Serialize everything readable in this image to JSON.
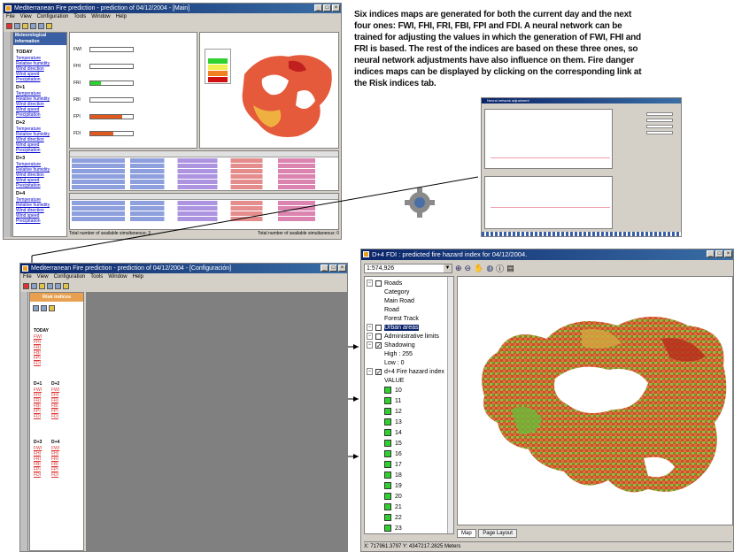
{
  "description": [
    "Six indices maps are generated for both the current day and the next",
    "four ones: FWI, FHI, FRI, FBI, FPI and FDI. A neural network can be",
    "trained for adjusting the values in which the generation of FWI, FHI and",
    "FRI is based. The rest of the indices are based on these three ones, so",
    "neural network adjustments have also influence on them. Fire danger",
    "indices maps can be displayed by clicking on the corresponding link at",
    "the Risk indices tab."
  ],
  "main_window": {
    "title": "Mediterranean Fire prediction - prediction of 04/12/2004 - [Main]",
    "menu": [
      "File",
      "View",
      "Configuration",
      "Tools",
      "Window",
      "Help"
    ],
    "left_header": "Meteorological information",
    "today": "TODAY",
    "days": [
      {
        "label": "TODAY",
        "links": [
          "Temperature",
          "Relative humidity",
          "Wind direction",
          "Wind speed",
          "Precipitation"
        ]
      },
      {
        "label": "D+1",
        "links": [
          "Temperature",
          "Relative humidity",
          "Wind direction",
          "Wind speed",
          "Precipitation"
        ]
      },
      {
        "label": "D+2",
        "links": [
          "Temperature",
          "Relative humidity",
          "Wind direction",
          "Wind speed",
          "Precipitation"
        ]
      },
      {
        "label": "D+3",
        "links": [
          "Temperature",
          "Relative humidity",
          "Wind direction",
          "Wind speed",
          "Precipitation"
        ]
      },
      {
        "label": "D+4",
        "links": [
          "Temperature",
          "Relative humidity",
          "Wind direction",
          "Wind speed",
          "Precipitation"
        ]
      }
    ],
    "indices": [
      "FWI",
      "FHI",
      "FRI",
      "FBI",
      "FPI",
      "FDI"
    ],
    "index_levels": [
      0,
      0,
      0.25,
      0,
      0.75,
      0.55
    ],
    "status_left": "Total number of available simultaneous: 3",
    "status_right": "Total number of available simultaneous: 0"
  },
  "zoom_window": {
    "title": "Mediterranean Fire prediction - prediction of 04/12/2004 - [Configuración]",
    "menu": [
      "File",
      "View",
      "Configuration",
      "Tools",
      "Window",
      "Help"
    ],
    "tab": "Risk indices",
    "groups": [
      "TODAY",
      "D+1",
      "D+2",
      "D+3",
      "D+4"
    ],
    "index_links": [
      "FWI",
      "FHI",
      "FRI",
      "FBI",
      "FPI",
      "FDI"
    ]
  },
  "chart_window": {
    "title": "Neural network adjustment"
  },
  "map_window": {
    "title": "D+4 FDI : predicted fire hazard index for 04/12/2004.",
    "scale": "1:574,926",
    "layers": [
      {
        "label": "Roads",
        "checked": false
      },
      {
        "label": "Category",
        "checked": false
      },
      {
        "label": "Main Road",
        "checked": false
      },
      {
        "label": "Road",
        "checked": false
      },
      {
        "label": "Forest Track",
        "checked": false
      },
      {
        "label": "Urban areas",
        "checked": false,
        "selected": true
      },
      {
        "label": "Administrative limits",
        "checked": false
      },
      {
        "label": "Shadowing",
        "checked": true
      },
      {
        "label": "High : 255",
        "checked": false
      },
      {
        "label": "Low : 0",
        "checked": false
      },
      {
        "label": "d+4 Fire hazard index",
        "checked": true
      },
      {
        "label": "VALUE",
        "checked": false
      }
    ],
    "values": [
      "10",
      "11",
      "12",
      "13",
      "14",
      "15",
      "16",
      "17",
      "18",
      "19",
      "20",
      "21",
      "22",
      "23",
      "24",
      "25"
    ],
    "tabs": [
      "Map",
      "Page Layout"
    ],
    "status": "X: 717961.3797 Y: 4347217.2825 Meters"
  }
}
